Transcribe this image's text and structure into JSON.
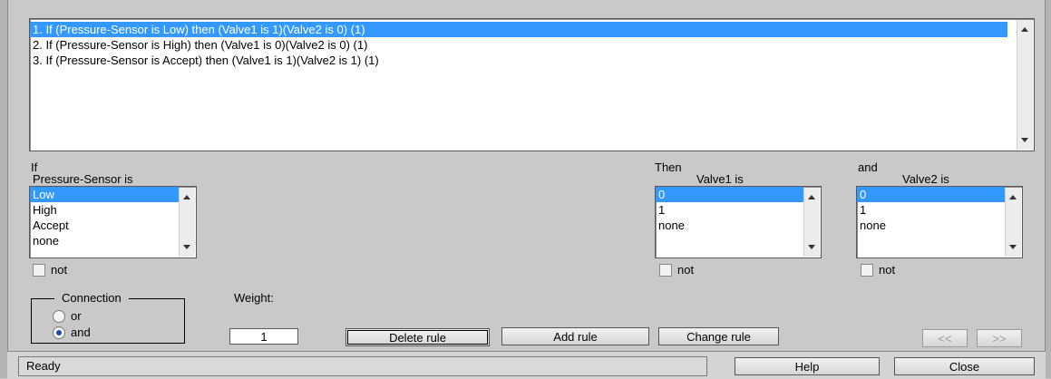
{
  "rules": {
    "items": [
      "1. If (Pressure-Sensor is Low) then (Valve1 is 1)(Valve2 is 0) (1)",
      "2. If (Pressure-Sensor is High) then (Valve1 is 0)(Valve2 is 0) (1)",
      "3. If (Pressure-Sensor is Accept) then (Valve1 is 1)(Valve2 is 1) (1)"
    ],
    "selected_index": 0
  },
  "input": {
    "header": "If",
    "variable_label": "Pressure-Sensor is",
    "options": [
      "Low",
      "High",
      "Accept",
      "none"
    ],
    "selected": "Low",
    "not_label": "not"
  },
  "output1": {
    "header": "Then",
    "variable_label": "Valve1 is",
    "options": [
      "0",
      "1",
      "none"
    ],
    "selected": "0",
    "not_label": "not"
  },
  "output2": {
    "header": "and",
    "variable_label": "Valve2 is",
    "options": [
      "0",
      "1",
      "none"
    ],
    "selected": "0",
    "not_label": "not"
  },
  "connection": {
    "title": "Connection",
    "or_label": "or",
    "and_label": "and",
    "selected": "and"
  },
  "weight": {
    "label": "Weight:",
    "value": "1"
  },
  "buttons": {
    "delete": "Delete rule",
    "add": "Add rule",
    "change": "Change rule",
    "prev": "<<",
    "next": ">>",
    "help": "Help",
    "close": "Close"
  },
  "status": "Ready"
}
